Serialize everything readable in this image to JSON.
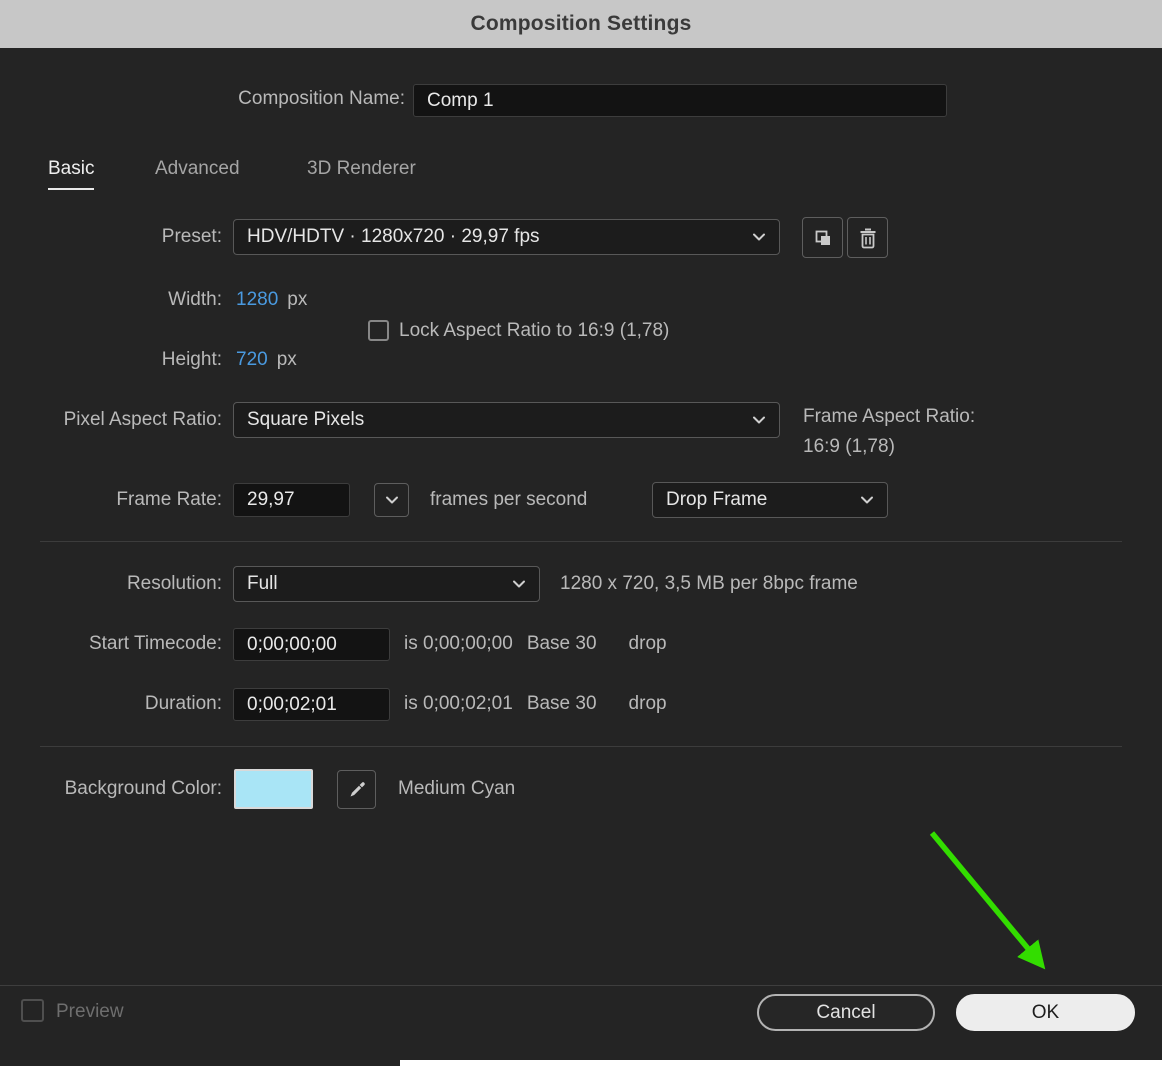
{
  "title_bar": {
    "title": "Composition Settings"
  },
  "composition_name": {
    "label": "Composition Name:",
    "value": "Comp 1"
  },
  "tabs": [
    {
      "label": "Basic"
    },
    {
      "label": "Advanced"
    },
    {
      "label": "3D Renderer"
    }
  ],
  "preset": {
    "label": "Preset:",
    "value": "HDV/HDTV  ·  1280x720 · 29,97 fps"
  },
  "size": {
    "width_label": "Width:",
    "width_value": "1280",
    "width_unit": "px",
    "height_label": "Height:",
    "height_value": "720",
    "height_unit": "px",
    "lock_aspect_label": "Lock Aspect Ratio to 16:9 (1,78)"
  },
  "pixel_aspect_ratio": {
    "label": "Pixel Aspect Ratio:",
    "value": "Square Pixels"
  },
  "frame_aspect_ratio": {
    "label": "Frame Aspect Ratio:",
    "value": "16:9 (1,78)"
  },
  "frame_rate": {
    "label": "Frame Rate:",
    "value": "29,97",
    "unit": "frames per second",
    "drop_frame": "Drop Frame"
  },
  "resolution": {
    "label": "Resolution:",
    "value": "Full",
    "info": "1280 x 720, 3,5 MB per 8bpc frame"
  },
  "start_timecode": {
    "label": "Start Timecode:",
    "value": "0;00;00;00",
    "converted": "is 0;00;00;00",
    "base": "Base 30",
    "drop": "drop"
  },
  "duration": {
    "label": "Duration:",
    "value": "0;00;02;01",
    "converted": "is 0;00;02;01",
    "base": "Base 30",
    "drop": "drop"
  },
  "background_color": {
    "label": "Background Color:",
    "swatch_hex": "#a9e5f6",
    "color_name": "Medium Cyan"
  },
  "footer": {
    "preview_label": "Preview",
    "cancel_label": "Cancel",
    "ok_label": "OK"
  },
  "colors": {
    "accent_blue": "#4a9ae0",
    "arrow_green": "#33dd00",
    "dialog_bg": "#242424",
    "titlebar_bg": "#c7c7c7"
  }
}
